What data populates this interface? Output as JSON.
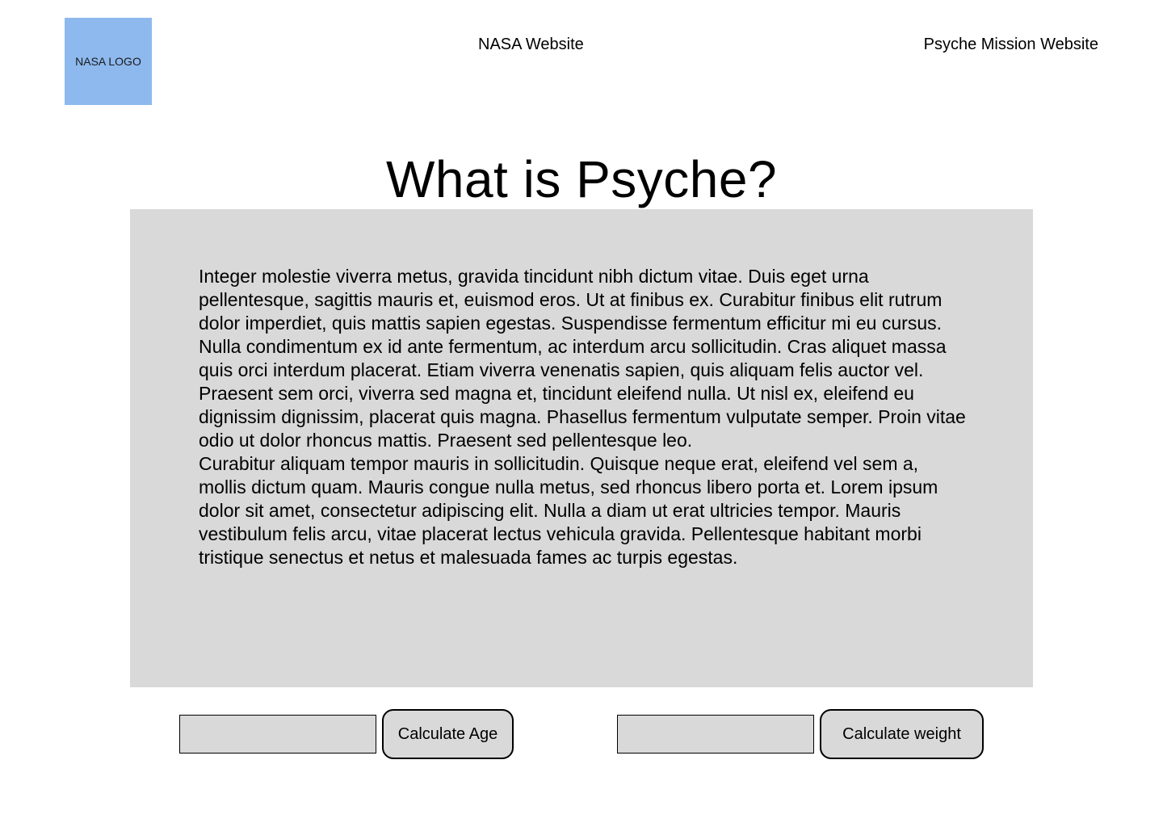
{
  "header": {
    "logo_text": "NASA LOGO",
    "nav": {
      "nasa_link": "NASA Website",
      "psyche_link": "Psyche Mission Website"
    }
  },
  "main": {
    "title": "What is Psyche?",
    "paragraphs": [
      "Integer molestie viverra metus, gravida tincidunt nibh dictum vitae. Duis eget urna pellentesque, sagittis mauris et, euismod eros. Ut at finibus ex. Curabitur finibus elit rutrum dolor imperdiet, quis mattis sapien egestas. Suspendisse fermentum efficitur mi eu cursus. Nulla condimentum ex id ante fermentum, ac interdum arcu sollicitudin. Cras aliquet massa quis orci interdum placerat. Etiam viverra venenatis sapien, quis aliquam felis auctor vel. Praesent sem orci, viverra sed magna et, tincidunt eleifend nulla. Ut nisl ex, eleifend eu dignissim dignissim, placerat quis magna. Phasellus fermentum vulputate semper. Proin vitae odio ut dolor rhoncus mattis. Praesent sed pellentesque leo.",
      "Curabitur aliquam tempor mauris in sollicitudin. Quisque neque erat, eleifend vel sem a, mollis dictum quam. Mauris congue nulla metus, sed rhoncus libero porta et. Lorem ipsum dolor sit amet, consectetur adipiscing elit. Nulla a diam ut erat ultricies tempor. Mauris vestibulum felis arcu, vitae placerat lectus vehicula gravida. Pellentesque habitant morbi tristique senectus et netus et malesuada fames ac turpis egestas."
    ]
  },
  "calculators": {
    "age": {
      "input_value": "",
      "button_label": "Calculate Age"
    },
    "weight": {
      "input_value": "",
      "button_label": "Calculate weight"
    }
  },
  "colors": {
    "logo_background": "#8db9ee",
    "panel_background": "#d9d9d9"
  }
}
